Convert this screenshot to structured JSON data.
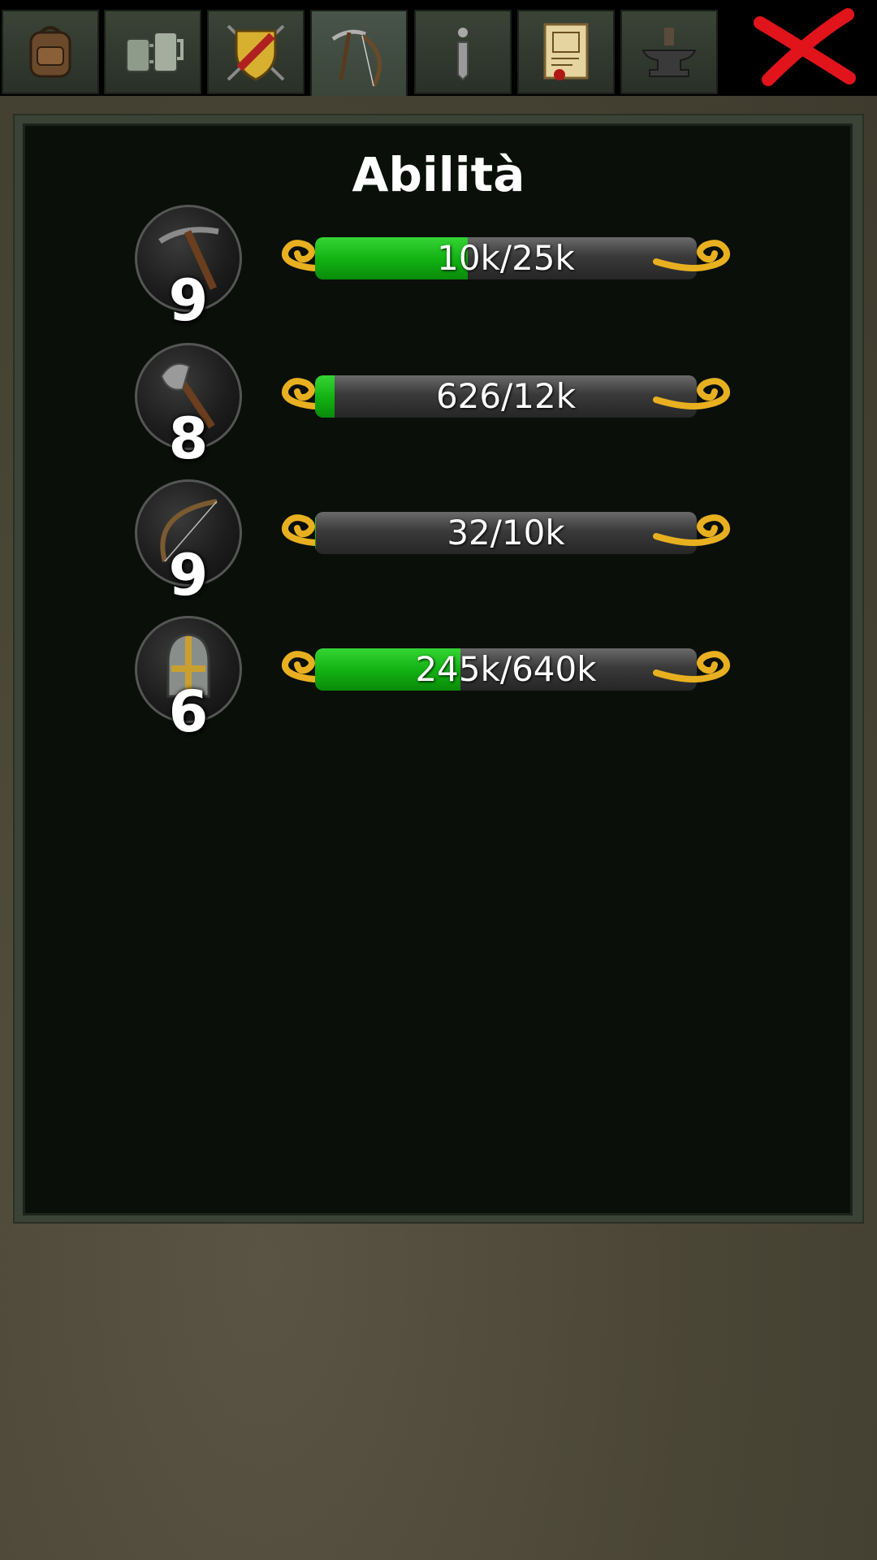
{
  "tabs": [
    {
      "name": "inventory",
      "icon": "backpack-icon"
    },
    {
      "name": "tavern",
      "icon": "tankards-icon"
    },
    {
      "name": "guild",
      "icon": "shield-swords-icon"
    },
    {
      "name": "skills",
      "icon": "pickaxe-bow-icon",
      "active": true
    },
    {
      "name": "info",
      "icon": "info-icon"
    },
    {
      "name": "quests",
      "icon": "scroll-icon"
    },
    {
      "name": "crafting",
      "icon": "anvil-icon"
    }
  ],
  "close_icon": "red-x-icon",
  "panel": {
    "title": "Abilità"
  },
  "skills": [
    {
      "icon": "pickaxe-icon",
      "level": "9",
      "progress_text": "10k/25k",
      "progress": 0.4
    },
    {
      "icon": "axe-icon",
      "level": "8",
      "progress_text": "626/12k",
      "progress": 0.05
    },
    {
      "icon": "bow-icon",
      "level": "9",
      "progress_text": "32/10k",
      "progress": 0.003
    },
    {
      "icon": "helmet-icon",
      "level": "6",
      "progress_text": "245k/640k",
      "progress": 0.38
    }
  ],
  "colors": {
    "progress_fill": "#11b011",
    "scroll_gold": "#e8b020",
    "close_red": "#e0141a"
  }
}
